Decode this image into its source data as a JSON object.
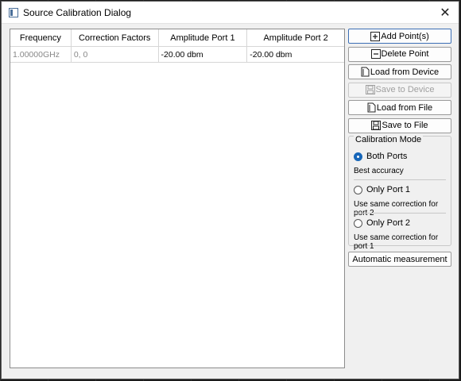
{
  "window": {
    "title": "Source Calibration Dialog",
    "close_glyph": "✕"
  },
  "table": {
    "headers": [
      "Frequency",
      "Correction Factors",
      "Amplitude Port 1",
      "Amplitude Port 2"
    ],
    "rows": [
      [
        "1.00000GHz",
        "0, 0",
        "-20.00 dbm",
        "-20.00 dbm"
      ]
    ]
  },
  "buttons": {
    "add_point": "Add Point(s)",
    "delete_point": "Delete Point",
    "load_from_device": "Load from Device",
    "save_to_device": "Save to Device",
    "load_from_file": "Load from File",
    "save_to_file": "Save to File",
    "automatic_measurement": "Automatic measurement"
  },
  "calibration_mode": {
    "title": "Calibration Mode",
    "options": [
      {
        "label": "Both Ports",
        "description": "Best accuracy",
        "checked": true
      },
      {
        "label": "Only Port 1",
        "description": "Use same correction for port 2",
        "checked": false
      },
      {
        "label": "Only Port 2",
        "description": "Use same correction for port 1",
        "checked": false
      }
    ]
  },
  "icons": {
    "add": "plus-square-icon",
    "delete": "minus-square-icon",
    "load": "open-file-icon",
    "save": "floppy-disk-icon"
  }
}
